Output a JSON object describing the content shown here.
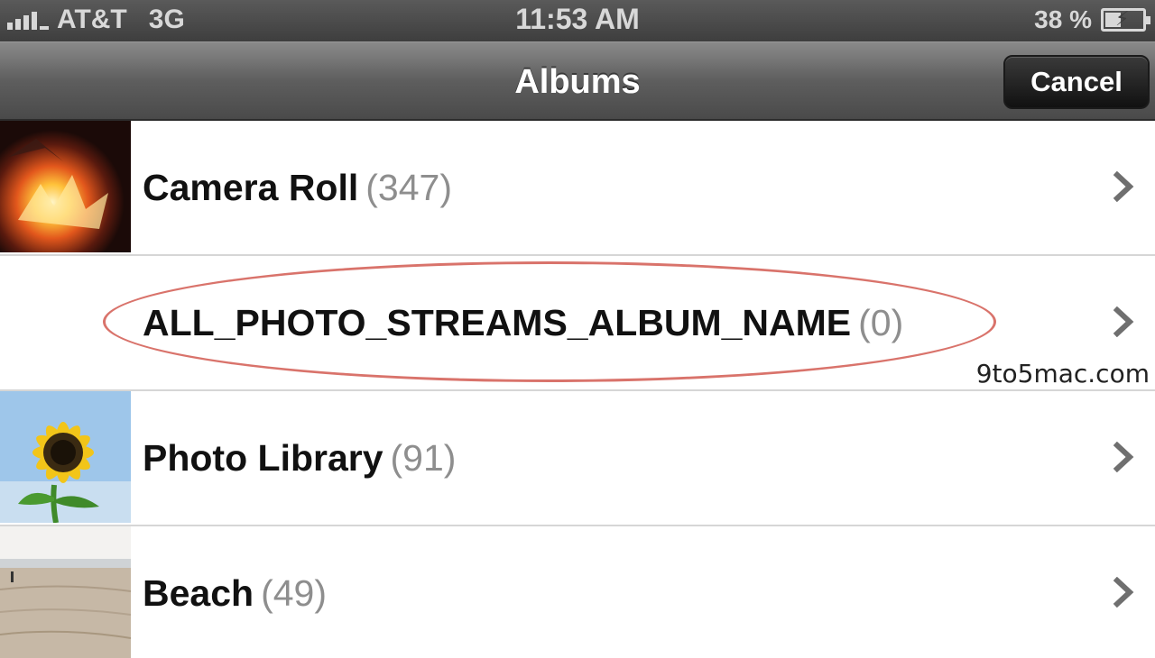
{
  "status_bar": {
    "carrier": "AT&T",
    "network": "3G",
    "time": "11:53 AM",
    "battery_percent": "38 %",
    "battery_level": 0.38
  },
  "nav": {
    "title": "Albums",
    "cancel_label": "Cancel"
  },
  "albums": [
    {
      "name": "Camera Roll",
      "count": "(347)",
      "thumbnail": "fire-photo"
    },
    {
      "name": "ALL_PHOTO_STREAMS_ALBUM_NAME",
      "count": "(0)",
      "thumbnail": "none"
    },
    {
      "name": "Photo Library",
      "count": "(91)",
      "thumbnail": "sunflower-photo"
    },
    {
      "name": "Beach",
      "count": "(49)",
      "thumbnail": "beach-photo"
    }
  ],
  "watermark": "9to5mac.com",
  "colors": {
    "highlight": "#d9736b",
    "count_gray": "#8e8e8e"
  }
}
